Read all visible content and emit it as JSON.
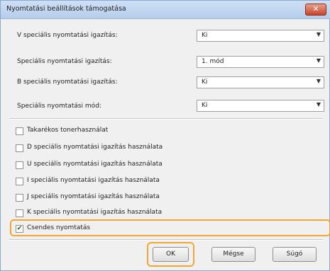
{
  "window": {
    "title": "Nyomtatási beállítások támogatása",
    "close_glyph": "✕"
  },
  "settings": [
    {
      "label": "V speciális nyomtatási igazítás:",
      "value": "Ki"
    },
    {
      "label": "Speciális nyomtatási igazítás:",
      "value": "1. mód"
    },
    {
      "label": "B speciális nyomtatási igazítás:",
      "value": "Ki"
    },
    {
      "label": "Speciális nyomtatási mód:",
      "value": "Ki"
    }
  ],
  "options": [
    {
      "label": "Takarékos tonerhasználat",
      "checked": false
    },
    {
      "label": "D speciális nyomtatási igazítás használata",
      "checked": false
    },
    {
      "label": "U speciális nyomtatási igazítás használata",
      "checked": false
    },
    {
      "label": "I speciális nyomtatási igazítás használata",
      "checked": false
    },
    {
      "label": "J speciális nyomtatási igazítás használata",
      "checked": false
    },
    {
      "label": "K speciális nyomtatási igazítás használata",
      "checked": false
    },
    {
      "label": "Csendes nyomtatás",
      "checked": true
    }
  ],
  "buttons": {
    "ok": "OK",
    "cancel": "Mégse",
    "help": "Súgó"
  },
  "colors": {
    "highlight": "#f3a732"
  }
}
